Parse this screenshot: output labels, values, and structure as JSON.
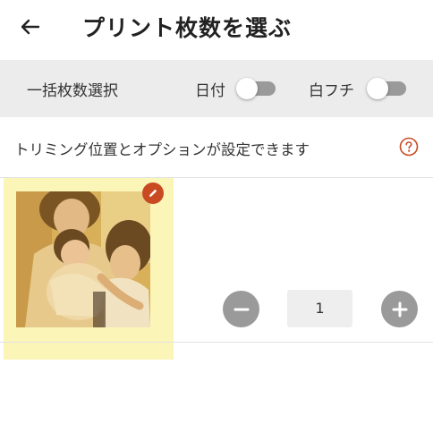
{
  "header": {
    "title": "プリント枚数を選ぶ",
    "back_icon": "arrow-left-icon"
  },
  "options": {
    "bulk_label": "一括枚数選択",
    "date_label": "日付",
    "date_toggle_on": false,
    "border_label": "白フチ",
    "border_toggle_on": false
  },
  "info": {
    "text": "トリミング位置とオプションが設定できます",
    "help_icon": "question-circle-icon"
  },
  "items": [
    {
      "photo_description_icon": "photo-thumbnail",
      "edit_icon": "pencil-icon",
      "quantity": "1",
      "minus_icon": "minus-icon",
      "plus_icon": "plus-icon"
    }
  ],
  "colors": {
    "accent": "#c94a22",
    "highlight": "#fbf5b8",
    "toggle_off": "#9a9a9a",
    "bar_bg": "#ececec"
  }
}
